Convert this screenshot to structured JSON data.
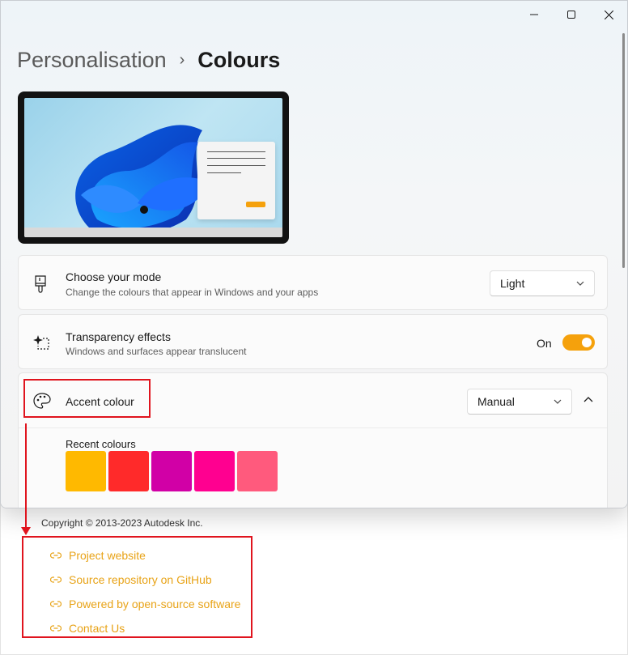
{
  "window": {
    "caption": {
      "minimize": "—",
      "maximize": "☐",
      "close": "✕"
    }
  },
  "breadcrumb": {
    "parent": "Personalisation",
    "separator": "›",
    "current": "Colours"
  },
  "mode": {
    "title": "Choose your mode",
    "subtitle": "Change the colours that appear in Windows and your apps",
    "selected": "Light",
    "icon": "paintbrush-icon"
  },
  "transparency": {
    "title": "Transparency effects",
    "subtitle": "Windows and surfaces appear translucent",
    "state_label": "On",
    "enabled": true,
    "icon": "sparkle-icon"
  },
  "accent": {
    "title": "Accent colour",
    "selected": "Manual",
    "icon": "palette-icon",
    "recent_label": "Recent colours",
    "recent_colours": [
      "#ffb900",
      "#ff2a2a",
      "#d100a6",
      "#ff0090",
      "#ff5a7d"
    ]
  },
  "colors": {
    "accent": "#f5a10c",
    "annotation": "#e0141e",
    "link": "#e8a317"
  },
  "about": {
    "copyright": "Copyright © 2013-2023 Autodesk Inc.",
    "links": [
      {
        "label": "Project website"
      },
      {
        "label": "Source repository on GitHub"
      },
      {
        "label": "Powered by open-source software"
      },
      {
        "label": "Contact Us"
      }
    ]
  }
}
